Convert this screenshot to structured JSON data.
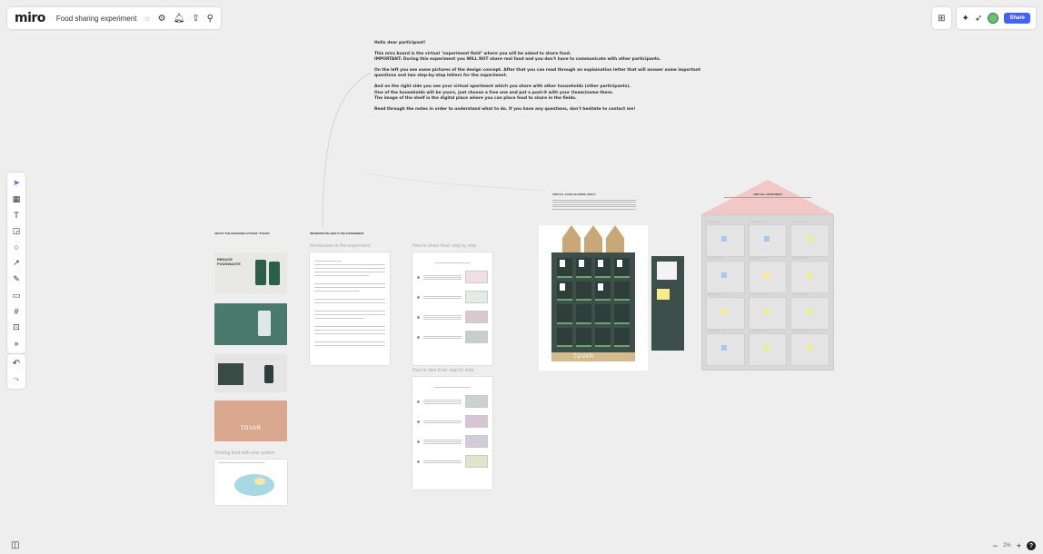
{
  "app": {
    "logo": "miro",
    "board_title": "Food sharing experiment"
  },
  "header_right": {
    "share_label": "Share"
  },
  "zoom": {
    "level": "2%",
    "minus": "−",
    "plus": "+",
    "help": "?"
  },
  "intro": {
    "greeting": "Hello dear participant!",
    "p1": "This miro board is the virtual \"experiment field\" where you will be asked to share food.",
    "p1b": "IMPORTANT: During this experiment you WILL NOT share real food and you don't have to communicate with other participants.",
    "p2": "On the left you see some pictures of the design concept. After that you can read through an explaination letter that will answer some important questions and two step-by-step letters for the experiment.",
    "p3": "And on the right side you see your virtual apartment which you share with other households (other participants).",
    "p3b": "One of the households will be yours, just choose a free one and put a post-it with your (team)name there.",
    "p3c": "The image of the shelf is the digital place where you can place food to share in the fields.",
    "p4": "Read through the notes in order to understand what to do. If you have any questions, don't hesitate to contact me!"
  },
  "sections": {
    "about": "ABOUT THE DESIGNED SYSTEM \"TOVAR\"",
    "info": "INFORMATION ABOUT THE EXPERIMENT",
    "intro_doc": "Introduction to the experiment",
    "how_share": "How to share food: step by step",
    "how_take": "How to take food: step by step",
    "sharing_new": "Sharing food with new system",
    "shelf_caption": "VIRTUAL FOOD SHARING SHELF",
    "apartment": "VIRTUAL APARTMENT"
  },
  "photos": {
    "reduce_line1": "REDUCE",
    "reduce_line2": "FOODWASTE",
    "tovar": "TOVAR"
  },
  "shelf": {
    "logo": "TOVAR"
  },
  "households": [
    "Household 1",
    "Household 2",
    "Household 3",
    "Household 4",
    "Household 5",
    "Household 6",
    "Household 7",
    "Household 8",
    "Household 9",
    "Household 10",
    "Household 11",
    "Household 12"
  ],
  "colors": {
    "accent": "#4262ff",
    "shelf_dark": "#3c4f4a",
    "roof_pink": "#f2c7c7",
    "wood": "#c9a877"
  }
}
